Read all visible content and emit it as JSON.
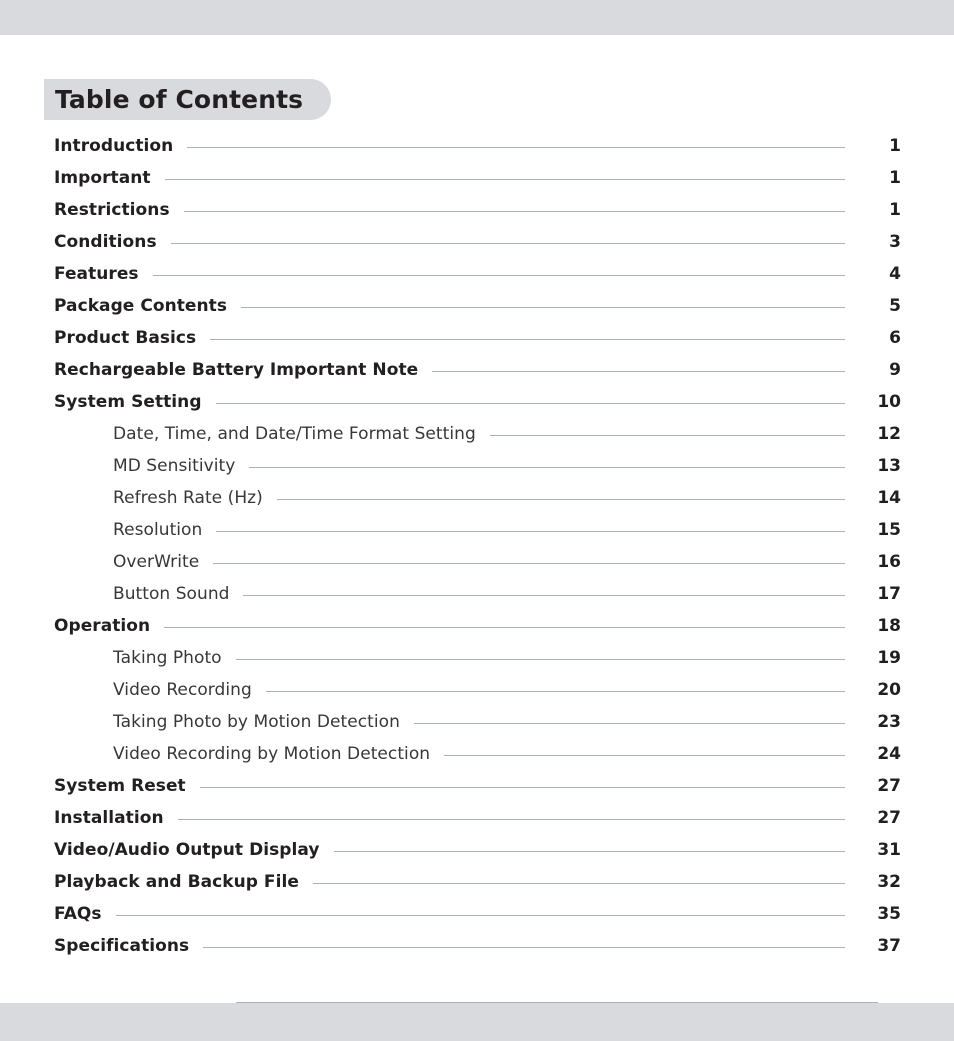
{
  "document": {
    "title": "Table of Contents"
  },
  "toc": {
    "entries": [
      {
        "label": "Introduction",
        "page": "1",
        "level": 1
      },
      {
        "label": "Important",
        "page": "1",
        "level": 1
      },
      {
        "label": "Restrictions",
        "page": "1",
        "level": 1
      },
      {
        "label": "Conditions",
        "page": "3",
        "level": 1
      },
      {
        "label": "Features",
        "page": "4",
        "level": 1
      },
      {
        "label": "Package Contents",
        "page": "5",
        "level": 1
      },
      {
        "label": "Product Basics",
        "page": "6",
        "level": 1
      },
      {
        "label": "Rechargeable Battery Important Note",
        "page": "9",
        "level": 1
      },
      {
        "label": "System Setting",
        "page": "10",
        "level": 1
      },
      {
        "label": "Date, Time, and Date/Time Format Setting",
        "page": "12",
        "level": 2
      },
      {
        "label": "MD Sensitivity",
        "page": "13",
        "level": 2
      },
      {
        "label": "Refresh Rate (Hz)",
        "page": "14",
        "level": 2
      },
      {
        "label": "Resolution",
        "page": "15",
        "level": 2
      },
      {
        "label": "OverWrite",
        "page": "16",
        "level": 2
      },
      {
        "label": "Button Sound",
        "page": "17",
        "level": 2
      },
      {
        "label": "Operation",
        "page": "18",
        "level": 1
      },
      {
        "label": "Taking Photo",
        "page": "19",
        "level": 2
      },
      {
        "label": "Video Recording",
        "page": "20",
        "level": 2
      },
      {
        "label": "Taking Photo by Motion Detection",
        "page": "23",
        "level": 2
      },
      {
        "label": "Video Recording by Motion Detection",
        "page": "24",
        "level": 2
      },
      {
        "label": "System Reset",
        "page": "27",
        "level": 1
      },
      {
        "label": "Installation",
        "page": "27",
        "level": 1
      },
      {
        "label": "Video/Audio Output Display",
        "page": "31",
        "level": 1
      },
      {
        "label": "Playback and Backup File",
        "page": "32",
        "level": 1
      },
      {
        "label": "FAQs",
        "page": "35",
        "level": 1
      },
      {
        "label": "Specifications",
        "page": "37",
        "level": 1
      }
    ]
  },
  "colors": {
    "band": "#d8dade",
    "text": "#231f20",
    "leader": "#a8b0bb"
  }
}
